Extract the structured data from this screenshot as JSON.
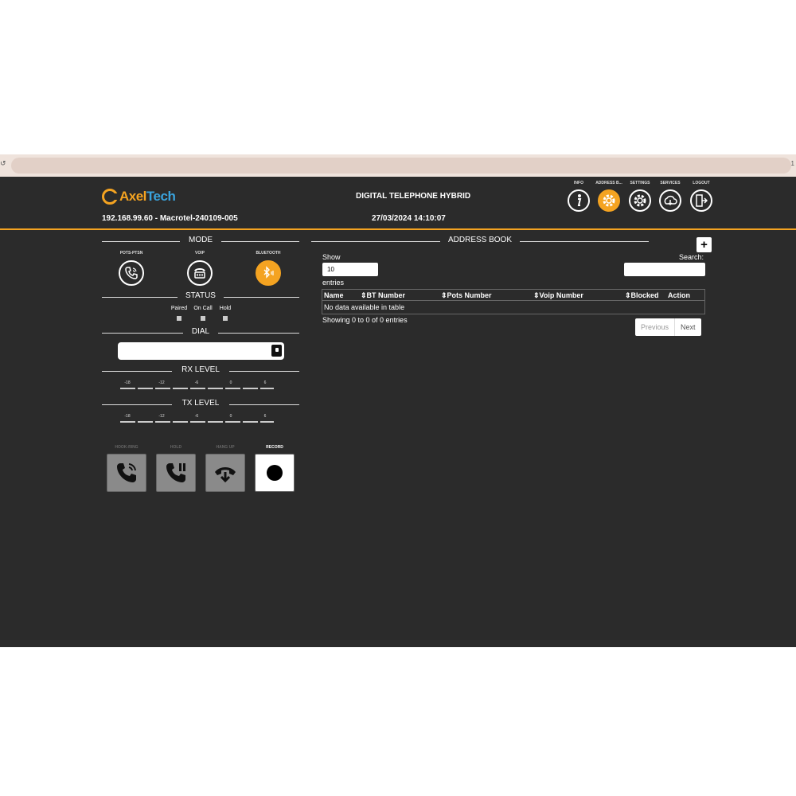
{
  "browser": {
    "reload_icon": "reload-icon",
    "edge_text": "1"
  },
  "header": {
    "logo_axel": "Axel",
    "logo_tech": "Tech",
    "title": "DIGITAL TELEPHONE HYBRID",
    "device_info": "192.168.99.60 - Macrotel-240109-005",
    "datetime": "27/03/2024 14:10:07",
    "accent_color": "#f4a321",
    "nav": [
      {
        "label": "INFO",
        "icon": "info-icon",
        "active": false
      },
      {
        "label": "ADDRESS B...",
        "icon": "address-book-gear-icon",
        "active": true
      },
      {
        "label": "SETTINGS",
        "icon": "settings-gear-icon",
        "active": false
      },
      {
        "label": "SERVICES",
        "icon": "cloud-download-icon",
        "active": false
      },
      {
        "label": "LOGOUT",
        "icon": "logout-icon",
        "active": false
      }
    ]
  },
  "left": {
    "mode": {
      "title": "MODE",
      "buttons": [
        {
          "label": "POTS-PTSN",
          "icon": "phone-icon",
          "active": false
        },
        {
          "label": "VOIP",
          "icon": "voip-phone-icon",
          "active": false
        },
        {
          "label": "BLUETOOTH",
          "icon": "bluetooth-icon",
          "active": true
        }
      ]
    },
    "status": {
      "title": "STATUS",
      "items": [
        "Paired",
        "On Call",
        "Hold"
      ]
    },
    "dial": {
      "title": "DIAL",
      "value": ""
    },
    "rx_level": {
      "title": "RX LEVEL",
      "ticks": [
        "-18",
        "-12",
        "-6",
        "0",
        "6"
      ]
    },
    "tx_level": {
      "title": "TX LEVEL",
      "ticks": [
        "-18",
        "-12",
        "-6",
        "0",
        "6"
      ]
    },
    "controls": [
      {
        "label": "HOOK-RING",
        "icon": "ringing-phone-icon",
        "enabled": false
      },
      {
        "label": "HOLD",
        "icon": "hold-phone-icon",
        "enabled": false
      },
      {
        "label": "HANG UP",
        "icon": "hang-up-icon",
        "enabled": false
      },
      {
        "label": "RECORD",
        "icon": "record-icon",
        "enabled": true
      }
    ]
  },
  "address_book": {
    "title": "ADDRESS BOOK",
    "add_label": "+",
    "show_label": "Show",
    "entries_value": "10",
    "entries_label": "entries",
    "search_label": "Search:",
    "search_value": "",
    "columns": [
      "Name",
      "BT Number",
      "Pots Number",
      "Voip Number",
      "Blocked",
      "Action"
    ],
    "empty_text": "No data available in table",
    "info_text": "Showing 0 to 0 of 0 entries",
    "prev_label": "Previous",
    "next_label": "Next"
  }
}
